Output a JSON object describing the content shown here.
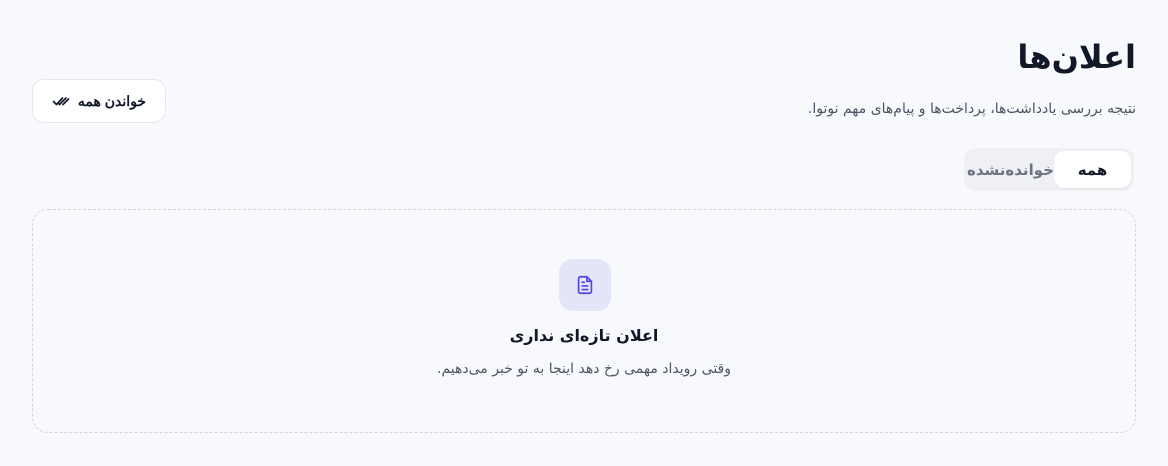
{
  "header": {
    "title": "اعلان‌ها",
    "subtitle": "نتیجه بررسی یادداشت‌ها، پرداخت‌ها و پیام‌های مهم نوتوا."
  },
  "actions": {
    "mark_all_read_label": "خواندن همه",
    "mark_all_read_icon": "double-check-icon"
  },
  "tabs": [
    {
      "label": "همه",
      "active": true
    },
    {
      "label": "خوانده‌نشده",
      "active": false
    }
  ],
  "empty_state": {
    "icon": "document-icon",
    "title": "اعلان تازه‌ای نداری",
    "description": "وقتی رویداد مهمی رخ دهد اینجا به تو خبر می‌دهیم."
  },
  "colors": {
    "background": "#f8f9fc",
    "accent": "#4f46e5",
    "icon_bg": "#e3e5f8"
  }
}
